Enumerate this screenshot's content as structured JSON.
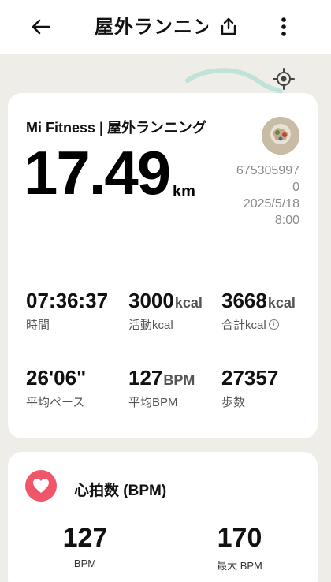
{
  "header": {
    "title": "屋外ランニン"
  },
  "icons": {
    "back": "arrow-left-icon",
    "share": "share-icon",
    "more": "more-vertical-icon",
    "locate": "locate-icon",
    "heart": "heart-icon",
    "info": "info-icon"
  },
  "summary": {
    "app_line": "Mi Fitness | 屋外ランニング",
    "distance_value": "17.49",
    "distance_unit": "km",
    "meta_id_line1": "675305997",
    "meta_id_line2": "0",
    "meta_date": "2025/5/18",
    "meta_time": "8:00"
  },
  "stats": [
    {
      "value": "07:36:37",
      "unit": "",
      "label": "時間",
      "info": false
    },
    {
      "value": "3000",
      "unit": "kcal",
      "label": "活動kcal",
      "info": false
    },
    {
      "value": "3668",
      "unit": "kcal",
      "label": "合計kcal",
      "info": true
    },
    {
      "value": "26'06\"",
      "unit": "",
      "label": "平均ペース",
      "info": false
    },
    {
      "value": "127",
      "unit": "BPM",
      "label": "平均BPM",
      "info": false
    },
    {
      "value": "27357",
      "unit": "",
      "label": "歩数",
      "info": false
    }
  ],
  "heart_rate": {
    "title": "心拍数 (BPM)",
    "avg_value": "127",
    "avg_label": "BPM",
    "max_value": "170",
    "max_label": "最大 BPM"
  },
  "colors": {
    "accent_heart": "#f0566a",
    "route": "#bfe3d8"
  }
}
